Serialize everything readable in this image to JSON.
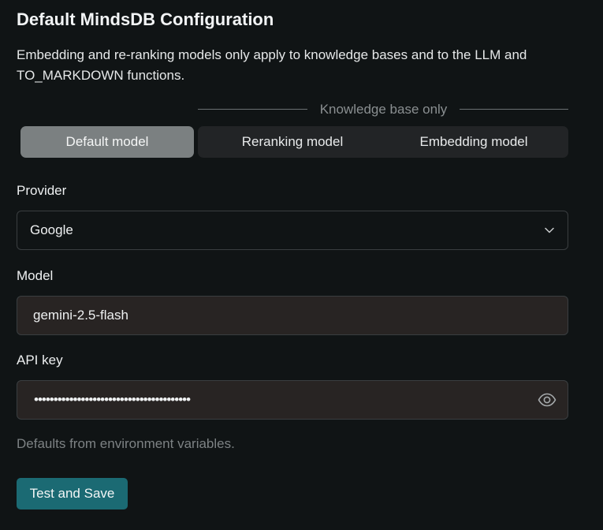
{
  "header": {
    "title": "Default MindsDB Configuration",
    "description": "Embedding and re-ranking models only apply to knowledge bases and to the LLM and TO_MARKDOWN functions."
  },
  "tabs": {
    "group_label": "Knowledge base only",
    "items": [
      {
        "label": "Default model",
        "active": true
      },
      {
        "label": "Reranking model",
        "active": false
      },
      {
        "label": "Embedding model",
        "active": false
      }
    ]
  },
  "form": {
    "provider": {
      "label": "Provider",
      "value": "Google"
    },
    "model": {
      "label": "Model",
      "value": "gemini-2.5-flash"
    },
    "api_key": {
      "label": "API key",
      "masked_value": "••••••••••••••••••••••••••••••••••••••••"
    },
    "hint": "Defaults from environment variables.",
    "save_label": "Test and Save"
  },
  "icons": {
    "select_chevron": "chevron-down-icon",
    "api_key_toggle": "eye-icon"
  },
  "colors": {
    "background": "#101415",
    "active_tab": "#7b8081",
    "tab_group": "#222426",
    "input_bg": "#282423",
    "primary_button": "#1b6a73"
  }
}
